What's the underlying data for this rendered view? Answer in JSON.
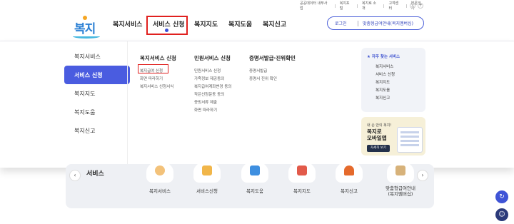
{
  "utility": {
    "links": [
      "공공데이터 내부사업",
      "복지포털",
      "복지로 소개",
      "고객센터",
      "본문크기"
    ],
    "zoom_minus": "-",
    "zoom_plus": "+"
  },
  "logo": {
    "text": "복지로"
  },
  "gnb": {
    "items": [
      "복지서비스",
      "서비스 신청",
      "복지지도",
      "복지도움",
      "복지신고"
    ]
  },
  "header_actions": {
    "login": "로그인",
    "custom": "맞춤형급여안내(복지멤버십)"
  },
  "lnb": {
    "items": [
      "복지서비스",
      "서비스 신청",
      "복지지도",
      "복지도움",
      "복지신고"
    ],
    "active_index": 1
  },
  "submenu": {
    "col1": {
      "title": "복지서비스 신청",
      "items": [
        "복지급여 신청",
        "화면 따라하기",
        "복지서비스 신청서식"
      ]
    },
    "col2": {
      "title": "민원서비스 신청",
      "items": [
        "민원서비스 신청",
        "가족정보 제공동의",
        "복지급여계좌변경 동의",
        "작은신청운동 동의",
        "증빙서류 제출",
        "화면 따라하기"
      ]
    },
    "col3": {
      "title": "증명서발급·진위확인",
      "items": [
        "증명서발급",
        "증명서 진위 확인"
      ]
    }
  },
  "favorites": {
    "title": "자주 찾는 서비스",
    "items": [
      "복지서비스",
      "서비스 신청",
      "복지지도",
      "복지도움",
      "복지신고"
    ]
  },
  "banner": {
    "line1": "내 손 안의 복지!",
    "line2a": "복지로",
    "line2b": "모바일앱",
    "button": "자세히 보기"
  },
  "quick": {
    "title": "서비스",
    "items": [
      "복지서비스",
      "서비스신청",
      "복지도움",
      "복지지도",
      "복지신고",
      "맞춤형급여안내\n(복지멤버십)"
    ],
    "icon_colors": [
      "#f3c27a",
      "#f1b64a",
      "#3e8fe0",
      "#e25a4a",
      "#e56a2c",
      "#d7b27a"
    ]
  },
  "colors": {
    "accent": "#4a5ce0",
    "highlight_box": "#e0201e"
  }
}
